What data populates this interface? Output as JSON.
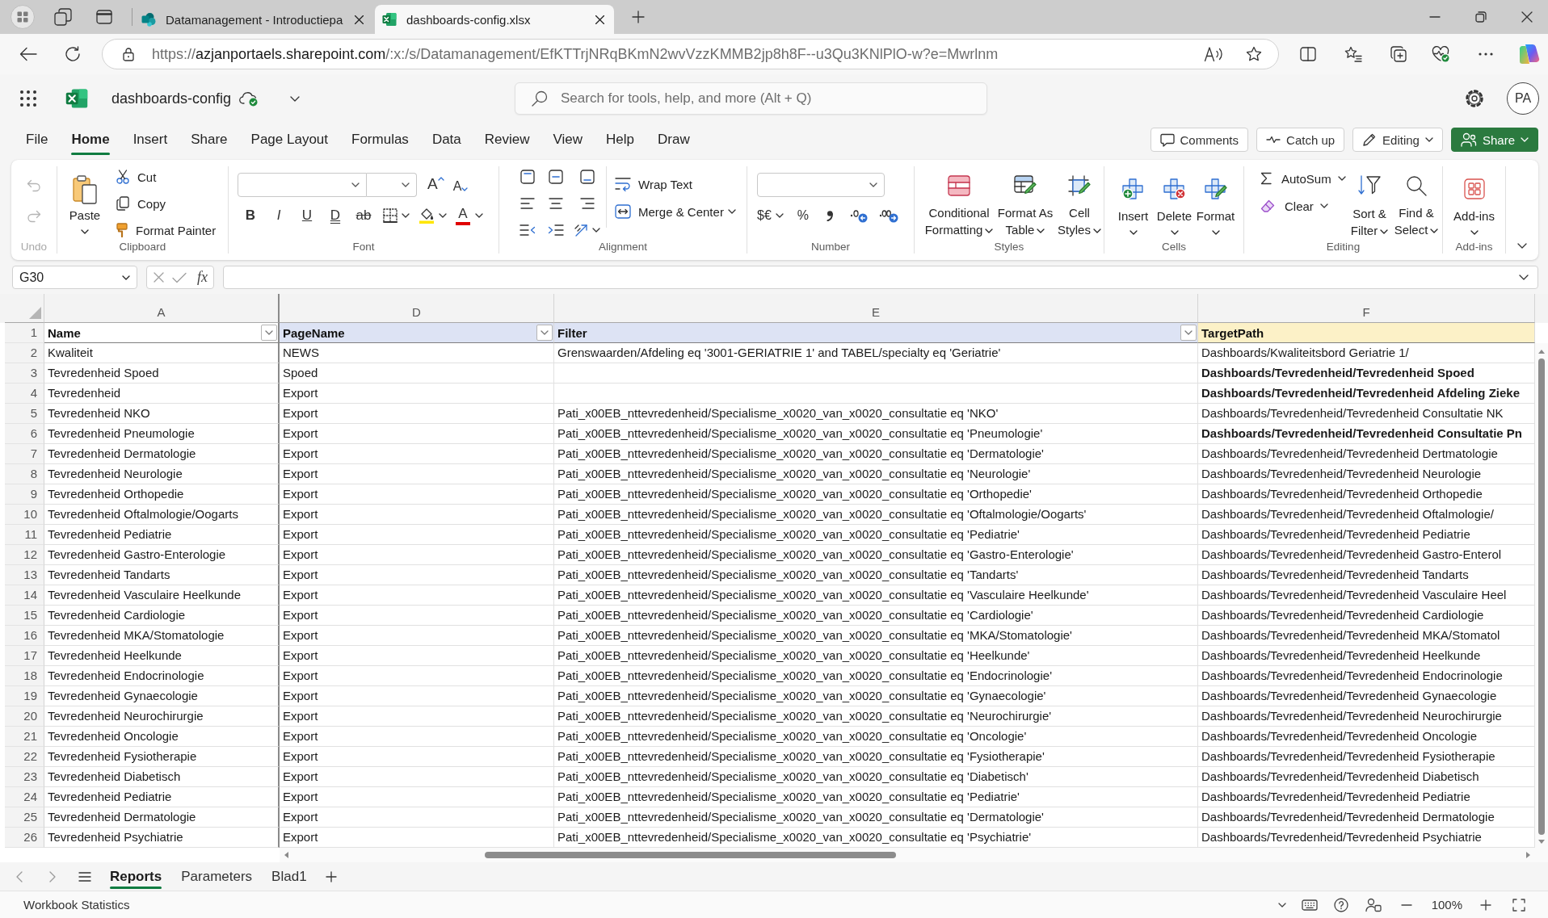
{
  "browser": {
    "tabs": [
      {
        "kind": "site",
        "title": "Datamanagement - Introductiepa",
        "selected": false
      },
      {
        "kind": "spreadsheet",
        "title": "dashboards-config.xlsx",
        "selected": true
      }
    ],
    "url": {
      "scheme": "https://",
      "host": "azjanportaels.sharepoint.com",
      "path": "/:x:/s/Datamanagement/EfKTTrjNRqBKmN2wvVzzKMMB2jp8h8F--u3Qu3KNlPlO-w?e=Mwrlnm"
    }
  },
  "app": {
    "file_name": "dashboards-config",
    "search": {
      "placeholder": "Search for tools, help, and more (Alt + Q)"
    },
    "avatar": "PA"
  },
  "menu_tabs": [
    {
      "label": "File",
      "selected": false
    },
    {
      "label": "Home",
      "selected": true
    },
    {
      "label": "Insert",
      "selected": false
    },
    {
      "label": "Share",
      "selected": false
    },
    {
      "label": "Page Layout",
      "selected": false
    },
    {
      "label": "Formulas",
      "selected": false
    },
    {
      "label": "Data",
      "selected": false
    },
    {
      "label": "Review",
      "selected": false
    },
    {
      "label": "View",
      "selected": false
    },
    {
      "label": "Help",
      "selected": false
    },
    {
      "label": "Draw",
      "selected": false
    }
  ],
  "header_buttons": [
    {
      "kind": "comments",
      "label": "Comments"
    },
    {
      "kind": "catch_up",
      "label": "Catch up"
    },
    {
      "kind": "editing",
      "label": "Editing"
    },
    {
      "kind": "share",
      "label": "Share"
    }
  ],
  "ribbon": {
    "undo": {
      "label": "Undo",
      "disabled": true
    },
    "clipboard": {
      "label": "Clipboard",
      "paste": "Paste",
      "commands": [
        {
          "kind": "cut",
          "label": "Cut"
        },
        {
          "kind": "copy",
          "label": "Copy"
        },
        {
          "kind": "format_painter",
          "label": "Format Painter"
        }
      ]
    },
    "font": {
      "label": "Font",
      "grow": "A",
      "shrink": "A",
      "styles": [
        {
          "kind": "bold",
          "glyph": "B"
        },
        {
          "kind": "italic",
          "glyph": "I"
        },
        {
          "kind": "underline",
          "glyph": "U"
        },
        {
          "kind": "double_underline",
          "glyph": "D"
        },
        {
          "kind": "strikethrough",
          "glyph": "ab"
        }
      ],
      "font_color": "A"
    },
    "alignment": {
      "label": "Alignment",
      "commands": [
        {
          "kind": "wrap_text",
          "label": "Wrap Text"
        },
        {
          "kind": "merge_center",
          "label": "Merge & Center"
        }
      ]
    },
    "number": {
      "label": "Number",
      "currency": "$€",
      "percent": "%"
    },
    "styles": {
      "label": "Styles",
      "commands": [
        {
          "kind": "conditional_formatting",
          "label": "Conditional Formatting"
        },
        {
          "kind": "format_as_table",
          "label": "Format As Table"
        },
        {
          "kind": "cell_styles",
          "label": "Cell Styles"
        }
      ]
    },
    "cells": {
      "label": "Cells",
      "commands": [
        {
          "kind": "insert",
          "label": "Insert"
        },
        {
          "kind": "delete",
          "label": "Delete"
        },
        {
          "kind": "format",
          "label": "Format"
        }
      ]
    },
    "editing": {
      "label": "Editing",
      "commands": [
        {
          "kind": "autosum",
          "label": "AutoSum"
        },
        {
          "kind": "clear",
          "label": "Clear"
        },
        {
          "kind": "sort_filter",
          "label": "Sort & Filter"
        },
        {
          "kind": "find_select",
          "label": "Find & Select"
        }
      ]
    },
    "add_ins": {
      "label": "Add-ins",
      "commands": [
        {
          "kind": "add_ins",
          "label": "Add-ins"
        }
      ]
    }
  },
  "formula_bar": {
    "name_box": "G30",
    "function_label": "fx"
  },
  "sheet": {
    "header_row_number": "1",
    "columns": [
      {
        "letter": "A",
        "header": "Name",
        "color": "#ffffff",
        "dropdown": true
      },
      {
        "letter": "D",
        "header": "PageName",
        "color": "#dde3f4",
        "dropdown": true
      },
      {
        "letter": "E",
        "header": "Filter",
        "color": "#dde3f4",
        "dropdown": true
      },
      {
        "letter": "F",
        "header": "TargetPath",
        "color": "#fcf1c7",
        "dropdown": false
      }
    ],
    "rows": [
      {
        "number": "2",
        "name": "Kwaliteit",
        "page_name": "NEWS",
        "filter": "Grenswaarden/Afdeling eq '3001-GERIATRIE 1' and TABEL/specialty eq 'Geriatrie'",
        "target_path": "Dashboards/Kwaliteitsbord Geriatrie 1/",
        "target_bold": false
      },
      {
        "number": "3",
        "name": "Tevredenheid Spoed",
        "page_name": "Spoed",
        "target_path": "Dashboards/Tevredenheid/Tevredenheid Spoed",
        "target_bold": true
      },
      {
        "number": "4",
        "name": "Tevredenheid",
        "page_name": "Export",
        "target_path": "Dashboards/Tevredenheid/Tevredenheid Afdeling Zieke",
        "target_bold": true
      },
      {
        "number": "5",
        "name": "Tevredenheid NKO",
        "page_name": "Export",
        "filter": "Pati_x00EB_nttevredenheid/Specialisme_x0020_van_x0020_consultatie eq 'NKO'",
        "target_path": "Dashboards/Tevredenheid/Tevredenheid Consultatie NK",
        "target_bold": false
      },
      {
        "number": "6",
        "name": "Tevredenheid Pneumologie",
        "page_name": "Export",
        "filter": "Pati_x00EB_nttevredenheid/Specialisme_x0020_van_x0020_consultatie eq 'Pneumologie'",
        "target_path": "Dashboards/Tevredenheid/Tevredenheid Consultatie Pn",
        "target_bold": true
      },
      {
        "number": "7",
        "name": "Tevredenheid Dermatologie",
        "page_name": "Export",
        "filter": "Pati_x00EB_nttevredenheid/Specialisme_x0020_van_x0020_consultatie eq 'Dermatologie'",
        "target_path": "Dashboards/Tevredenheid/Tevredenheid Dertmatologie",
        "target_bold": false
      },
      {
        "number": "8",
        "name": "Tevredenheid Neurologie",
        "page_name": "Export",
        "filter": "Pati_x00EB_nttevredenheid/Specialisme_x0020_van_x0020_consultatie eq 'Neurologie'",
        "target_path": "Dashboards/Tevredenheid/Tevredenheid Neurologie",
        "target_bold": false
      },
      {
        "number": "9",
        "name": "Tevredenheid Orthopedie",
        "page_name": "Export",
        "filter": "Pati_x00EB_nttevredenheid/Specialisme_x0020_van_x0020_consultatie eq 'Orthopedie'",
        "target_path": "Dashboards/Tevredenheid/Tevredenheid Orthopedie",
        "target_bold": false
      },
      {
        "number": "10",
        "name": "Tevredenheid Oftalmologie/Oogarts",
        "page_name": "Export",
        "filter": "Pati_x00EB_nttevredenheid/Specialisme_x0020_van_x0020_consultatie eq 'Oftalmologie/Oogarts'",
        "target_path": "Dashboards/Tevredenheid/Tevredenheid Oftalmologie/",
        "target_bold": false
      },
      {
        "number": "11",
        "name": "Tevredenheid Pediatrie",
        "page_name": "Export",
        "filter": "Pati_x00EB_nttevredenheid/Specialisme_x0020_van_x0020_consultatie eq 'Pediatrie'",
        "target_path": "Dashboards/Tevredenheid/Tevredenheid Pediatrie",
        "target_bold": false
      },
      {
        "number": "12",
        "name": "Tevredenheid Gastro-Enterologie",
        "page_name": "Export",
        "filter": "Pati_x00EB_nttevredenheid/Specialisme_x0020_van_x0020_consultatie eq 'Gastro-Enterologie'",
        "target_path": "Dashboards/Tevredenheid/Tevredenheid Gastro-Enterol",
        "target_bold": false
      },
      {
        "number": "13",
        "name": "Tevredenheid Tandarts",
        "page_name": "Export",
        "filter": "Pati_x00EB_nttevredenheid/Specialisme_x0020_van_x0020_consultatie eq 'Tandarts'",
        "target_path": "Dashboards/Tevredenheid/Tevredenheid Tandarts",
        "target_bold": false
      },
      {
        "number": "14",
        "name": "Tevredenheid Vasculaire Heelkunde",
        "page_name": "Export",
        "filter": "Pati_x00EB_nttevredenheid/Specialisme_x0020_van_x0020_consultatie eq 'Vasculaire Heelkunde'",
        "target_path": "Dashboards/Tevredenheid/Tevredenheid Vasculaire Heel",
        "target_bold": false
      },
      {
        "number": "15",
        "name": "Tevredenheid Cardiologie",
        "page_name": "Export",
        "filter": "Pati_x00EB_nttevredenheid/Specialisme_x0020_van_x0020_consultatie eq 'Cardiologie'",
        "target_path": "Dashboards/Tevredenheid/Tevredenheid Cardiologie",
        "target_bold": false
      },
      {
        "number": "16",
        "name": "Tevredenheid MKA/Stomatologie",
        "page_name": "Export",
        "filter": "Pati_x00EB_nttevredenheid/Specialisme_x0020_van_x0020_consultatie eq 'MKA/Stomatologie'",
        "target_path": "Dashboards/Tevredenheid/Tevredenheid MKA/Stomatol",
        "target_bold": false
      },
      {
        "number": "17",
        "name": "Tevredenheid Heelkunde",
        "page_name": "Export",
        "filter": "Pati_x00EB_nttevredenheid/Specialisme_x0020_van_x0020_consultatie eq 'Heelkunde'",
        "target_path": "Dashboards/Tevredenheid/Tevredenheid Heelkunde",
        "target_bold": false
      },
      {
        "number": "18",
        "name": "Tevredenheid Endocrinologie",
        "page_name": "Export",
        "filter": "Pati_x00EB_nttevredenheid/Specialisme_x0020_van_x0020_consultatie eq 'Endocrinologie'",
        "target_path": "Dashboards/Tevredenheid/Tevredenheid Endocrinologie",
        "target_bold": false
      },
      {
        "number": "19",
        "name": "Tevredenheid Gynaecologie",
        "page_name": "Export",
        "filter": "Pati_x00EB_nttevredenheid/Specialisme_x0020_van_x0020_consultatie eq 'Gynaecologie'",
        "target_path": "Dashboards/Tevredenheid/Tevredenheid Gynaecologie",
        "target_bold": false
      },
      {
        "number": "20",
        "name": "Tevredenheid Neurochirurgie",
        "page_name": "Export",
        "filter": "Pati_x00EB_nttevredenheid/Specialisme_x0020_van_x0020_consultatie eq 'Neurochirurgie'",
        "target_path": "Dashboards/Tevredenheid/Tevredenheid Neurochirurgie",
        "target_bold": false
      },
      {
        "number": "21",
        "name": "Tevredenheid Oncologie",
        "page_name": "Export",
        "filter": "Pati_x00EB_nttevredenheid/Specialisme_x0020_van_x0020_consultatie eq 'Oncologie'",
        "target_path": "Dashboards/Tevredenheid/Tevredenheid Oncologie",
        "target_bold": false
      },
      {
        "number": "22",
        "name": "Tevredenheid Fysiotherapie",
        "page_name": "Export",
        "filter": "Pati_x00EB_nttevredenheid/Specialisme_x0020_van_x0020_consultatie eq 'Fysiotherapie'",
        "target_path": "Dashboards/Tevredenheid/Tevredenheid Fysiotherapie",
        "target_bold": false
      },
      {
        "number": "23",
        "name": "Tevredenheid Diabetisch",
        "page_name": "Export",
        "filter": "Pati_x00EB_nttevredenheid/Specialisme_x0020_van_x0020_consultatie eq 'Diabetisch'",
        "target_path": "Dashboards/Tevredenheid/Tevredenheid Diabetisch",
        "target_bold": false
      },
      {
        "number": "24",
        "name": "Tevredenheid Pediatrie",
        "page_name": "Export",
        "filter": "Pati_x00EB_nttevredenheid/Specialisme_x0020_van_x0020_consultatie eq 'Pediatrie'",
        "target_path": "Dashboards/Tevredenheid/Tevredenheid Pediatrie",
        "target_bold": false
      },
      {
        "number": "25",
        "name": "Tevredenheid Dermatologie",
        "page_name": "Export",
        "filter": "Pati_x00EB_nttevredenheid/Specialisme_x0020_van_x0020_consultatie eq 'Dermatologie'",
        "target_path": "Dashboards/Tevredenheid/Tevredenheid Dermatologie",
        "target_bold": false
      },
      {
        "number": "26",
        "name": "Tevredenheid Psychiatrie",
        "page_name": "Export",
        "filter": "Pati_x00EB_nttevredenheid/Specialisme_x0020_van_x0020_consultatie eq 'Psychiatrie'",
        "target_path": "Dashboards/Tevredenheid/Tevredenheid Psychiatrie",
        "target_bold": false
      }
    ]
  },
  "sheet_tabs": [
    {
      "label": "Reports",
      "selected": true
    },
    {
      "label": "Parameters",
      "selected": false
    },
    {
      "label": "Blad1",
      "selected": false
    }
  ],
  "status_bar": {
    "label": "Workbook Statistics",
    "zoom": "100%"
  }
}
